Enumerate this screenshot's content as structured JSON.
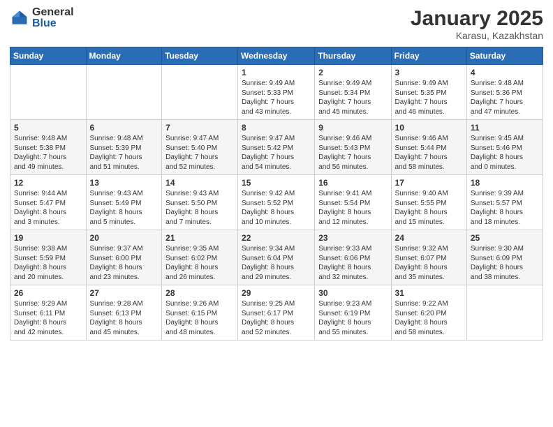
{
  "logo": {
    "general": "General",
    "blue": "Blue"
  },
  "header": {
    "title": "January 2025",
    "subtitle": "Karasu, Kazakhstan"
  },
  "weekdays": [
    "Sunday",
    "Monday",
    "Tuesday",
    "Wednesday",
    "Thursday",
    "Friday",
    "Saturday"
  ],
  "weeks": [
    [
      {
        "day": "",
        "info": ""
      },
      {
        "day": "",
        "info": ""
      },
      {
        "day": "",
        "info": ""
      },
      {
        "day": "1",
        "info": "Sunrise: 9:49 AM\nSunset: 5:33 PM\nDaylight: 7 hours\nand 43 minutes."
      },
      {
        "day": "2",
        "info": "Sunrise: 9:49 AM\nSunset: 5:34 PM\nDaylight: 7 hours\nand 45 minutes."
      },
      {
        "day": "3",
        "info": "Sunrise: 9:49 AM\nSunset: 5:35 PM\nDaylight: 7 hours\nand 46 minutes."
      },
      {
        "day": "4",
        "info": "Sunrise: 9:48 AM\nSunset: 5:36 PM\nDaylight: 7 hours\nand 47 minutes."
      }
    ],
    [
      {
        "day": "5",
        "info": "Sunrise: 9:48 AM\nSunset: 5:38 PM\nDaylight: 7 hours\nand 49 minutes."
      },
      {
        "day": "6",
        "info": "Sunrise: 9:48 AM\nSunset: 5:39 PM\nDaylight: 7 hours\nand 51 minutes."
      },
      {
        "day": "7",
        "info": "Sunrise: 9:47 AM\nSunset: 5:40 PM\nDaylight: 7 hours\nand 52 minutes."
      },
      {
        "day": "8",
        "info": "Sunrise: 9:47 AM\nSunset: 5:42 PM\nDaylight: 7 hours\nand 54 minutes."
      },
      {
        "day": "9",
        "info": "Sunrise: 9:46 AM\nSunset: 5:43 PM\nDaylight: 7 hours\nand 56 minutes."
      },
      {
        "day": "10",
        "info": "Sunrise: 9:46 AM\nSunset: 5:44 PM\nDaylight: 7 hours\nand 58 minutes."
      },
      {
        "day": "11",
        "info": "Sunrise: 9:45 AM\nSunset: 5:46 PM\nDaylight: 8 hours\nand 0 minutes."
      }
    ],
    [
      {
        "day": "12",
        "info": "Sunrise: 9:44 AM\nSunset: 5:47 PM\nDaylight: 8 hours\nand 3 minutes."
      },
      {
        "day": "13",
        "info": "Sunrise: 9:43 AM\nSunset: 5:49 PM\nDaylight: 8 hours\nand 5 minutes."
      },
      {
        "day": "14",
        "info": "Sunrise: 9:43 AM\nSunset: 5:50 PM\nDaylight: 8 hours\nand 7 minutes."
      },
      {
        "day": "15",
        "info": "Sunrise: 9:42 AM\nSunset: 5:52 PM\nDaylight: 8 hours\nand 10 minutes."
      },
      {
        "day": "16",
        "info": "Sunrise: 9:41 AM\nSunset: 5:54 PM\nDaylight: 8 hours\nand 12 minutes."
      },
      {
        "day": "17",
        "info": "Sunrise: 9:40 AM\nSunset: 5:55 PM\nDaylight: 8 hours\nand 15 minutes."
      },
      {
        "day": "18",
        "info": "Sunrise: 9:39 AM\nSunset: 5:57 PM\nDaylight: 8 hours\nand 18 minutes."
      }
    ],
    [
      {
        "day": "19",
        "info": "Sunrise: 9:38 AM\nSunset: 5:59 PM\nDaylight: 8 hours\nand 20 minutes."
      },
      {
        "day": "20",
        "info": "Sunrise: 9:37 AM\nSunset: 6:00 PM\nDaylight: 8 hours\nand 23 minutes."
      },
      {
        "day": "21",
        "info": "Sunrise: 9:35 AM\nSunset: 6:02 PM\nDaylight: 8 hours\nand 26 minutes."
      },
      {
        "day": "22",
        "info": "Sunrise: 9:34 AM\nSunset: 6:04 PM\nDaylight: 8 hours\nand 29 minutes."
      },
      {
        "day": "23",
        "info": "Sunrise: 9:33 AM\nSunset: 6:06 PM\nDaylight: 8 hours\nand 32 minutes."
      },
      {
        "day": "24",
        "info": "Sunrise: 9:32 AM\nSunset: 6:07 PM\nDaylight: 8 hours\nand 35 minutes."
      },
      {
        "day": "25",
        "info": "Sunrise: 9:30 AM\nSunset: 6:09 PM\nDaylight: 8 hours\nand 38 minutes."
      }
    ],
    [
      {
        "day": "26",
        "info": "Sunrise: 9:29 AM\nSunset: 6:11 PM\nDaylight: 8 hours\nand 42 minutes."
      },
      {
        "day": "27",
        "info": "Sunrise: 9:28 AM\nSunset: 6:13 PM\nDaylight: 8 hours\nand 45 minutes."
      },
      {
        "day": "28",
        "info": "Sunrise: 9:26 AM\nSunset: 6:15 PM\nDaylight: 8 hours\nand 48 minutes."
      },
      {
        "day": "29",
        "info": "Sunrise: 9:25 AM\nSunset: 6:17 PM\nDaylight: 8 hours\nand 52 minutes."
      },
      {
        "day": "30",
        "info": "Sunrise: 9:23 AM\nSunset: 6:19 PM\nDaylight: 8 hours\nand 55 minutes."
      },
      {
        "day": "31",
        "info": "Sunrise: 9:22 AM\nSunset: 6:20 PM\nDaylight: 8 hours\nand 58 minutes."
      },
      {
        "day": "",
        "info": ""
      }
    ]
  ]
}
